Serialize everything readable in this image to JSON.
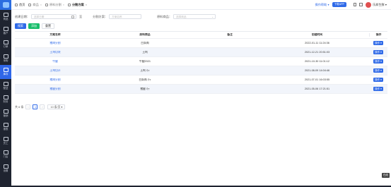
{
  "sidebar": {
    "logo_icon": "app-logo",
    "items": [
      {
        "label": "商品",
        "icon": "goods-icon",
        "active": false
      },
      {
        "label": "客户",
        "icon": "customer-icon",
        "active": false
      },
      {
        "label": "订单",
        "icon": "order-icon",
        "active": false
      },
      {
        "label": "采购",
        "icon": "purchase-icon",
        "active": false
      },
      {
        "label": "库存",
        "icon": "stock-icon",
        "active": true
      },
      {
        "label": "配送",
        "icon": "delivery-icon",
        "active": false
      },
      {
        "label": "财务",
        "icon": "finance-icon",
        "active": false
      },
      {
        "label": "营销",
        "icon": "marketing-icon",
        "active": false
      },
      {
        "label": "报表",
        "icon": "report-icon",
        "active": false
      },
      {
        "label": "员工",
        "icon": "staff-icon",
        "active": false
      },
      {
        "label": "门店",
        "icon": "store-icon",
        "active": false
      },
      {
        "label": "设置",
        "icon": "settings-icon",
        "active": false
      }
    ]
  },
  "topbar": {
    "tabs": [
      {
        "label": "首页",
        "kind": "home"
      },
      {
        "label": "商品",
        "kind": "normal"
      },
      {
        "label": "原料分割",
        "kind": "normal"
      },
      {
        "label": "分割方案",
        "kind": "current"
      }
    ],
    "help_link": "操作帮助 ▾",
    "download_btn": "下载APP",
    "user_name": "乐邦生鲜 ▾"
  },
  "filter": {
    "created_label": "创建日期：",
    "created_placeholder": "选择日期",
    "date_sep": "至",
    "plan_label": "分割方案：",
    "plan_placeholder": "方案名称",
    "material_label": "原料商品：",
    "material_placeholder": "选择商品"
  },
  "actions": {
    "search": "搜索",
    "add": "添加",
    "reset": "重置"
  },
  "table": {
    "headers": [
      "方案名称",
      "原料商品",
      "备注",
      "创建时间",
      "操作"
    ],
    "rows": [
      {
        "name": "猪肉分割",
        "material": "白条肉",
        "note": "",
        "created": "2022-01-11 11:24:36",
        "op": "操作 ▾"
      },
      {
        "name": "土鸡切块",
        "material": "土鸡",
        "note": "",
        "created": "2021-12-21 20:51:03",
        "op": "操作 ▾"
      },
      {
        "name": "牛腿",
        "material": "牛腿2021",
        "note": "",
        "created": "2021-10-30 11:01:12",
        "op": "操作 ▾"
      },
      {
        "name": "土鸡切开",
        "material": "土鸡 /斤",
        "note": "",
        "created": "2021-08-09 14:04:46",
        "op": "操作 ▾"
      },
      {
        "name": "猪肉分割",
        "material": "白条肉 /斤",
        "note": "",
        "created": "2021-07-01 16:03:55",
        "op": "操作 ▾"
      },
      {
        "name": "猪腿分割",
        "material": "猪腿 /斤",
        "note": "",
        "created": "2021-05-06 17:21:51",
        "op": "操作 ▾"
      }
    ]
  },
  "pager": {
    "total": "共 6 条",
    "prev": "‹",
    "current": "1",
    "next": "›",
    "size": "10 条/页 ▾"
  },
  "float_tag": "在线"
}
